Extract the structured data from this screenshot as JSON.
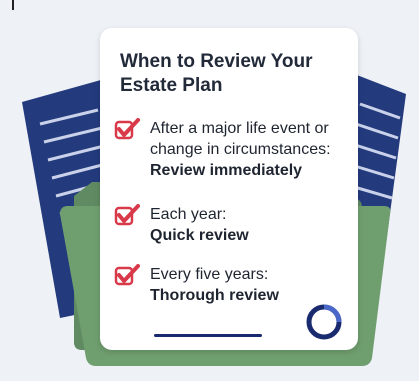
{
  "card": {
    "title": "When to Review Your Estate Plan"
  },
  "items": [
    {
      "line1": "After a major life event or",
      "line2": "change in circumstances:",
      "emphasis": "Review immediately"
    },
    {
      "line1": "Each year:",
      "line2": "",
      "emphasis": "Quick review"
    },
    {
      "line1": "Every five years:",
      "line2": "",
      "emphasis": "Thorough review"
    }
  ],
  "colors": {
    "check": "#d83a4a",
    "folder": "#6f9e6f",
    "folder_back": "#5f8a62",
    "document": "#233a7d",
    "accent": "#1a2a6e"
  },
  "icons": {
    "check": "check-mark-icon",
    "badge": "circle-logo-icon"
  }
}
